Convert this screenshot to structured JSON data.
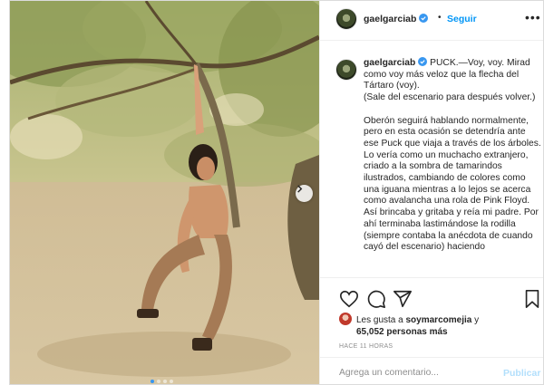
{
  "post": {
    "author": {
      "username": "gaelgarciab",
      "verified": true,
      "follow_label": "Seguir",
      "separator": "•"
    },
    "caption": {
      "username": "gaelgarciab",
      "paragraphs": [
        "PUCK.—Voy, voy. Mirad como voy más veloz que la flecha del Tártaro (voy).\n(Sale del escenario para después volver.)",
        "Oberón seguirá hablando normalmente, pero en esta ocasión se detendría ante ese Puck que viaja a través de los árboles. Lo vería como un muchacho extranjero, criado a la sombra de tamarindos ilustrados, cambiando de colores como una iguana mientras a lo lejos se acerca como avalancha una rola de Pink Floyd.\nAsí brincaba y gritaba y reía mi padre. Por ahí terminaba lastimándose la rodilla (siempre contaba la anécdota de cuando cayó del escenario) haciendo"
      ]
    },
    "likes": {
      "prefix": "Les gusta a",
      "liker": "soymarcomejia",
      "connector": "y",
      "count_text": "65,052 personas más"
    },
    "timestamp": "HACE 11 HORAS",
    "comment": {
      "placeholder": "Agrega un comentario...",
      "publish_label": "Publicar"
    },
    "carousel": {
      "slide_count": 4,
      "current_slide": 1
    },
    "icons": {
      "more": "more-options-icon",
      "like": "heart-icon",
      "comment": "comment-icon",
      "share": "share-icon",
      "save": "bookmark-icon",
      "next": "chevron-right-icon",
      "verified": "verified-badge-icon"
    },
    "colors": {
      "accent": "#0095f6",
      "verified": "#3897f0",
      "publish_disabled": "#b2dffc",
      "muted_text": "#8e8e8e"
    }
  }
}
